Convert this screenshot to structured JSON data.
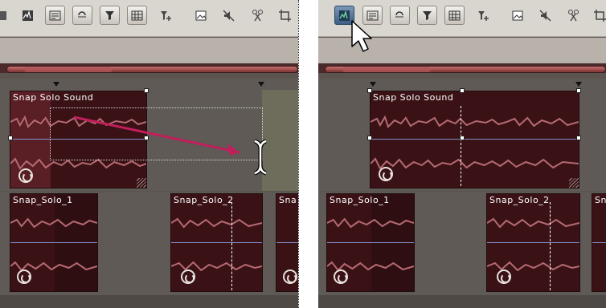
{
  "left_panel": {
    "toolbar": {
      "icons": [
        "clip-edit-icon",
        "snap-icon",
        "loop-icon",
        "filter-icon",
        "grid-icon",
        "add-effect-icon",
        "image-icon",
        "mute-icon",
        "split-icon",
        "crop-icon"
      ],
      "active_icon": ""
    },
    "top_clip": {
      "title": "Snap Solo Sound"
    },
    "bottom_clips": [
      {
        "title": "Snap_Solo_1"
      },
      {
        "title": "Snap_Solo_2"
      },
      {
        "title": "Sna"
      }
    ],
    "drag_arrow": {
      "color": "#c01f5b"
    }
  },
  "right_panel": {
    "toolbar": {
      "icons": [
        "clip-edit-icon",
        "snap-icon",
        "loop-icon",
        "filter-icon",
        "grid-icon",
        "add-effect-icon",
        "image-icon",
        "mute-icon",
        "split-icon",
        "crop-icon"
      ],
      "active_icon": "clip-edit-icon"
    },
    "top_clip": {
      "title": "Snap Solo Sound"
    },
    "bottom_clips": [
      {
        "title": "Snap_Solo_1"
      },
      {
        "title": "Snap_Solo_2"
      },
      {
        "title": "Sn"
      }
    ]
  },
  "colors": {
    "clip_fill": "#3a1216",
    "waveform": "#b56a72",
    "track_bg": "#5f5a55",
    "arrow": "#c01f5b"
  }
}
